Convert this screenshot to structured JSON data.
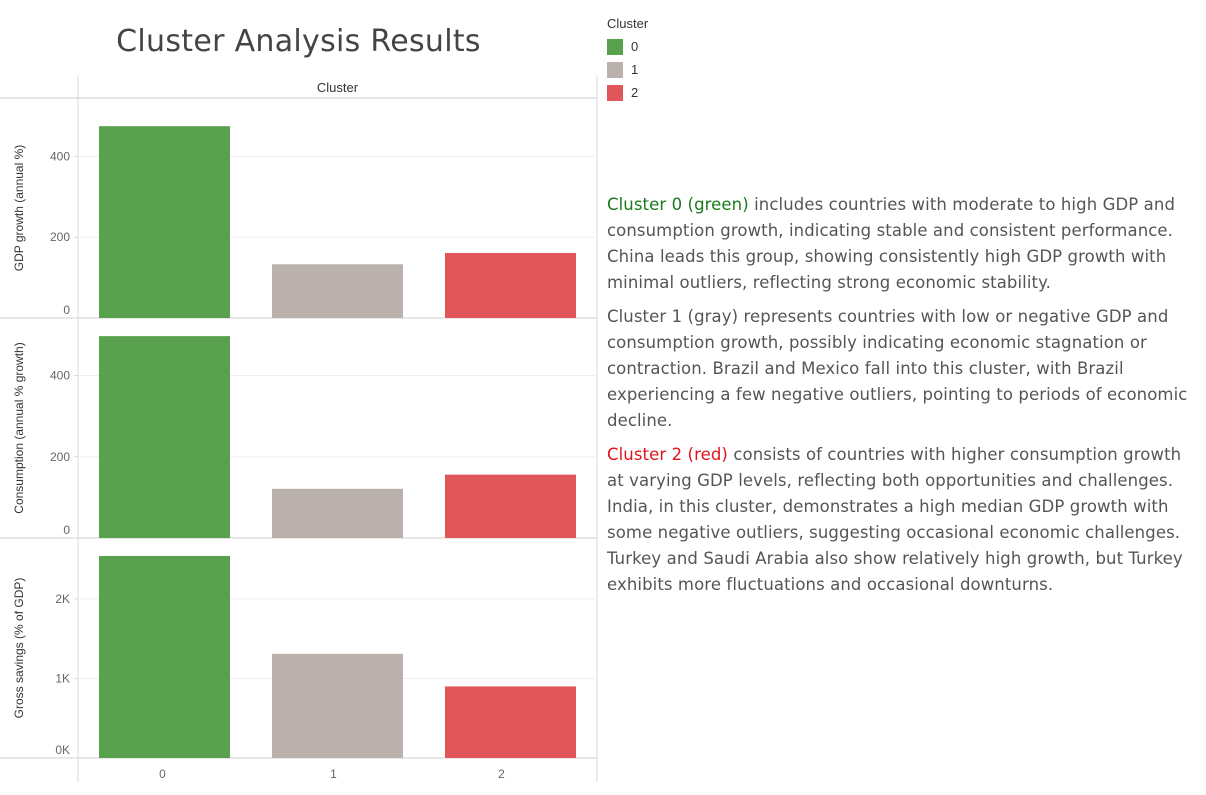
{
  "title": "Cluster Analysis Results",
  "legend": {
    "title": "Cluster",
    "items": [
      {
        "label": "0",
        "color": "#59a14f"
      },
      {
        "label": "1",
        "color": "#bab0ac"
      },
      {
        "label": "2",
        "color": "#e15759"
      }
    ]
  },
  "notes": [
    {
      "highlight": "Cluster 0 (green)",
      "highlight_color": "#1a7a1a",
      "text": " includes countries with moderate to high GDP and consumption growth, indicating stable and consistent performance. China leads this group, showing consistently high GDP growth with minimal outliers, reflecting strong economic stability."
    },
    {
      "highlight": "Cluster 1 (gray)",
      "highlight_color": "#555555",
      "text": " represents countries with low or negative GDP and consumption growth, possibly indicating economic stagnation or contraction. Brazil and Mexico fall into this cluster, with Brazil experiencing a few negative outliers, pointing to periods of economic decline."
    },
    {
      "highlight": "Cluster 2 (red)",
      "highlight_color": "#e0141a",
      "text": " consists of countries with higher consumption growth at varying GDP levels, reflecting both opportunities and challenges. India, in this cluster, demonstrates a high median GDP growth with some negative outliers, suggesting occasional economic challenges. Turkey and Saudi Arabia also show relatively high growth, but Turkey exhibits more fluctuations and occasional downturns."
    }
  ],
  "chart_data": {
    "type": "bar",
    "header": "Cluster",
    "categories": [
      "0",
      "1",
      "2"
    ],
    "colors": [
      "#59a14f",
      "#bab0ac",
      "#e15759"
    ],
    "panels": [
      {
        "ylabel": "GDP growth (annual %)",
        "values": [
          475,
          133,
          161
        ],
        "ylim": [
          0,
          520
        ],
        "ticks": [
          {
            "v": 0,
            "label": "0"
          },
          {
            "v": 200,
            "label": "200"
          },
          {
            "v": 400,
            "label": "400"
          }
        ]
      },
      {
        "ylabel": "Consumption (annual % growth)",
        "values": [
          497,
          121,
          156
        ],
        "ylim": [
          0,
          517
        ],
        "ticks": [
          {
            "v": 0,
            "label": "0"
          },
          {
            "v": 200,
            "label": "200"
          },
          {
            "v": 400,
            "label": "400"
          }
        ]
      },
      {
        "ylabel": "Gross savings (% of GDP)",
        "values": [
          2540,
          1310,
          900
        ],
        "ylim": [
          0,
          2640
        ],
        "ticks": [
          {
            "v": 0,
            "label": "0K"
          },
          {
            "v": 1000,
            "label": "1K"
          },
          {
            "v": 2000,
            "label": "2K"
          }
        ]
      }
    ]
  }
}
